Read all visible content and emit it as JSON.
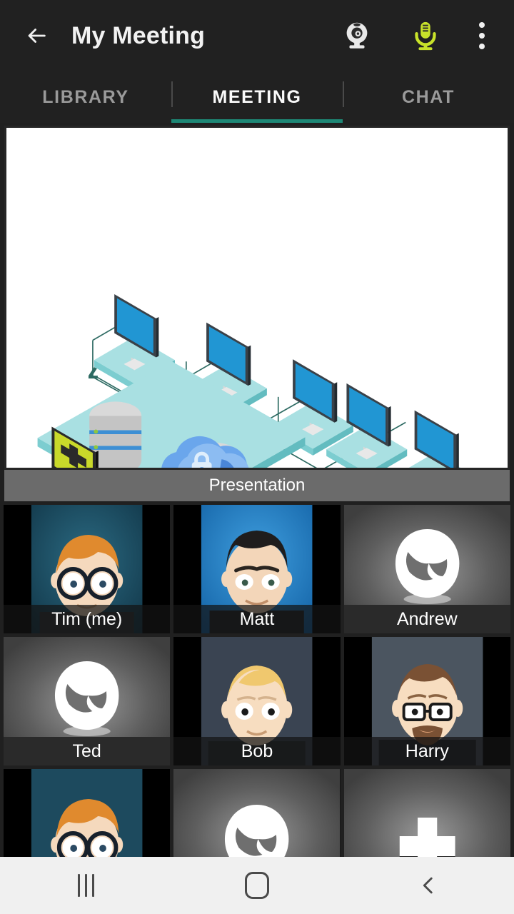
{
  "header": {
    "back_icon": "arrow-left-icon",
    "title": "My Meeting",
    "camera_icon": "webcam-icon",
    "camera_color": "#e8e8e8",
    "mic_icon": "microphone-icon",
    "mic_color": "#c8e22a",
    "overflow_icon": "kebab-menu-icon"
  },
  "tabs": {
    "items": [
      {
        "label": "LIBRARY",
        "active": false
      },
      {
        "label": "MEETING",
        "active": true
      },
      {
        "label": "CHAT",
        "active": false
      }
    ],
    "indicator_color": "#1e8876",
    "active_text_color": "#fafafa",
    "inactive_text_color": "#9a9a9a"
  },
  "presentation": {
    "label": "Presentation",
    "label_bg": "#6b6b6b",
    "stage_bg": "#ffffff",
    "diagram": {
      "kind": "isometric-network-diagram",
      "platform_color": "#9fdde0",
      "screen_color": "#2196d3",
      "link_color": "#2e6b63",
      "cloud_color": "#5b9ce8",
      "lock_color": "#d6e9fb",
      "server_color": "#cfcfcf",
      "highlight_monitor_color": "#c9d92a"
    }
  },
  "participants": [
    {
      "name": "Tim (me)",
      "video": true,
      "avatar": "tim",
      "bg": "#1d4a5e"
    },
    {
      "name": "Matt",
      "video": true,
      "avatar": "matt",
      "bg": "#1f76bd"
    },
    {
      "name": "Andrew",
      "video": false,
      "avatar": "none",
      "bg": "#4a4a4a"
    },
    {
      "name": "Ted",
      "video": false,
      "avatar": "none",
      "bg": "#4a4a4a"
    },
    {
      "name": "Bob",
      "video": true,
      "avatar": "bob",
      "bg": "#3a4452"
    },
    {
      "name": "Harry",
      "video": true,
      "avatar": "harry",
      "bg": "#4b5560"
    },
    {
      "name": "",
      "video": true,
      "avatar": "tim",
      "bg": "#1d4a5e"
    },
    {
      "name": "",
      "video": false,
      "avatar": "none",
      "bg": "#4a4a4a"
    },
    {
      "name": "",
      "video": false,
      "avatar": "add",
      "bg": "#4a4a4a"
    }
  ],
  "navbar": {
    "recents_label": "recents-icon",
    "home_label": "home-icon",
    "back_label": "back-icon",
    "bg": "#f0f0f0"
  }
}
